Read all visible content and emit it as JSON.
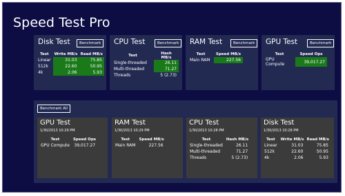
{
  "app": {
    "title": "Speed Test Pro"
  },
  "panels": [
    {
      "title": "Disk Test",
      "button": "Benchmark",
      "headers": [
        "Test",
        "Write MB/s",
        "Read MB/s"
      ],
      "rows": [
        [
          "Linear",
          "31.03",
          "75.85"
        ],
        [
          "512k",
          "22.60",
          "50.95"
        ],
        [
          "4k",
          "2.06",
          "5.93"
        ]
      ]
    },
    {
      "title": "CPU Test",
      "button": "Benchmark",
      "headers": [
        "Test",
        "Hash MB/s"
      ],
      "rows": [
        [
          "Single-threaded",
          "26.11"
        ],
        [
          "Multi-threaded",
          "71.27"
        ],
        [
          "Threads",
          "5 (2.73)"
        ]
      ]
    },
    {
      "title": "RAM Test",
      "button": "Benchmark",
      "headers": [
        "Test",
        "Speed MB/s"
      ],
      "rows": [
        [
          "Main RAM",
          "227.56"
        ]
      ]
    },
    {
      "title": "GPU Test",
      "button": "Benchmark",
      "headers": [
        "Test",
        "Speed Ops"
      ],
      "rows": [
        [
          "GPU Compute",
          "39,017.27"
        ]
      ]
    }
  ],
  "results": {
    "button": "Benchmark All",
    "cards": [
      {
        "title": "GPU Test",
        "date": "1/30/2013 10:29 PM",
        "headers": [
          "Test",
          "Speed Ops"
        ],
        "rows": [
          [
            "GPU Compute",
            "39,017.27"
          ]
        ]
      },
      {
        "title": "RAM Test",
        "date": "1/30/2013 10:29 PM",
        "headers": [
          "Test",
          "Speed MB/s"
        ],
        "rows": [
          [
            "Main RAM",
            "227.56"
          ]
        ]
      },
      {
        "title": "CPU Test",
        "date": "1/30/2013 10:28 PM",
        "headers": [
          "Test",
          "Hash MB/s"
        ],
        "rows": [
          [
            "Single-threaded",
            "26.11"
          ],
          [
            "Multi-threaded",
            "71.27"
          ],
          [
            "Threads",
            "5 (2.73)"
          ]
        ]
      },
      {
        "title": "Disk Test",
        "date": "1/30/2013 10:28 PM",
        "headers": [
          "Test",
          "Write MB/s",
          "Read MB/s"
        ],
        "rows": [
          [
            "Linear",
            "31.03",
            "75.85"
          ],
          [
            "512k",
            "22.60",
            "50.95"
          ],
          [
            "4k",
            "2.06",
            "5.93"
          ]
        ]
      }
    ]
  }
}
